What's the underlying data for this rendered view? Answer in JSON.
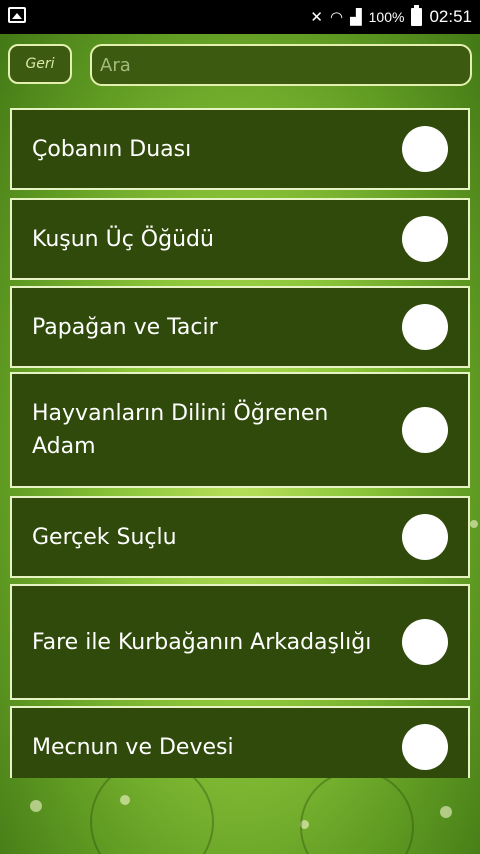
{
  "status_bar": {
    "battery_percent": "100%",
    "time": "02:51"
  },
  "topbar": {
    "back_label": "Geri",
    "search_placeholder": "Ara",
    "search_value": ""
  },
  "stories": [
    {
      "title": "Çobanın Duası",
      "selected": false
    },
    {
      "title": "Kuşun Üç Öğüdü",
      "selected": false
    },
    {
      "title": "Papağan ve Tacir",
      "selected": false
    },
    {
      "title": "Hayvanların Dilini Öğrenen Adam",
      "selected": false
    },
    {
      "title": "Gerçek Suçlu",
      "selected": false
    },
    {
      "title": "Fare ile Kurbağanın Arkadaşlığı",
      "selected": false
    },
    {
      "title": "Mecnun ve Devesi",
      "selected": false
    }
  ],
  "colors": {
    "item_background": "#2f4a0a",
    "item_border": "#e8f3c4",
    "background_green": "#8cc63a"
  }
}
